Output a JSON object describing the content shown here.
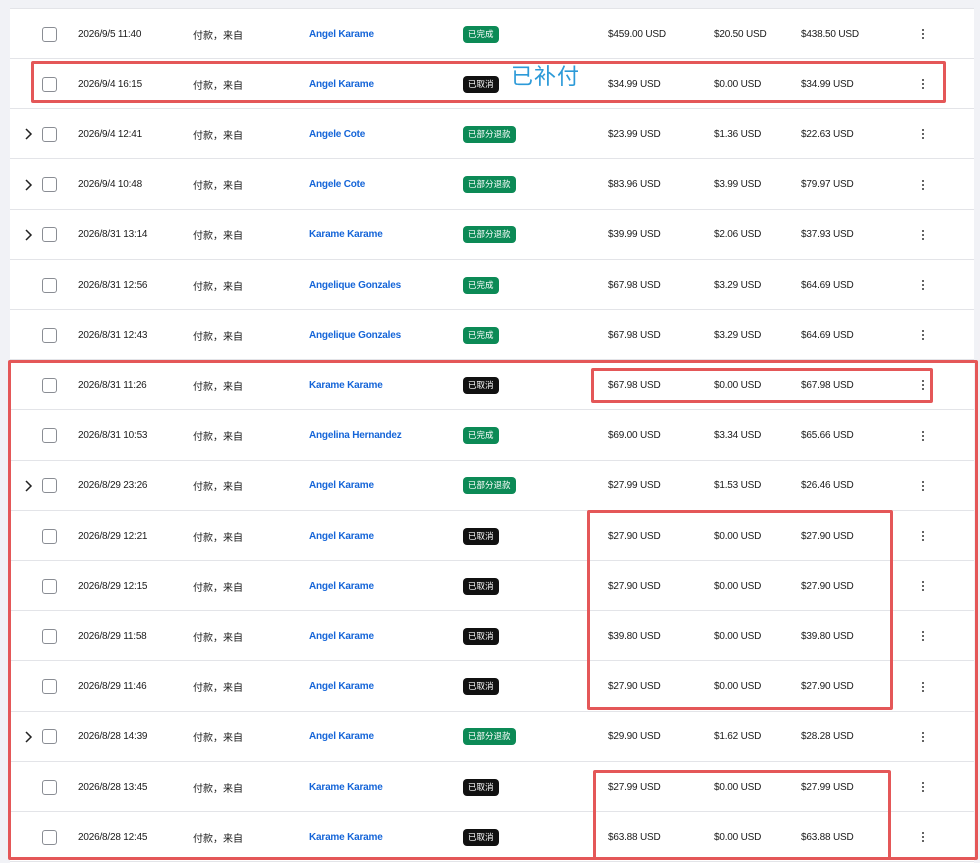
{
  "annotation_note": "已补付",
  "colors": {
    "link": "#1565d8",
    "badge_complete": "#0c8a56",
    "badge_partial_refund": "#0c8a56",
    "badge_cancelled": "#111111",
    "highlight": "#e45758",
    "note": "#2c9ad8"
  },
  "rows": [
    {
      "expandable": false,
      "date": "2026/9/5 11:40",
      "type": "付款，来自",
      "customer": "Angel Karame",
      "status": "已完成",
      "status_kind": "green",
      "amount": "$459.00 USD",
      "fee": "$20.50 USD",
      "net": "$438.50 USD"
    },
    {
      "expandable": false,
      "date": "2026/9/4 16:15",
      "type": "付款，来自",
      "customer": "Angel Karame",
      "status": "已取消",
      "status_kind": "black",
      "amount": "$34.99 USD",
      "fee": "$0.00 USD",
      "net": "$34.99 USD"
    },
    {
      "expandable": true,
      "date": "2026/9/4 12:41",
      "type": "付款，来自",
      "customer": "Angele Cote",
      "status": "已部分退款",
      "status_kind": "green",
      "amount": "$23.99 USD",
      "fee": "$1.36 USD",
      "net": "$22.63 USD"
    },
    {
      "expandable": true,
      "date": "2026/9/4 10:48",
      "type": "付款，来自",
      "customer": "Angele Cote",
      "status": "已部分退款",
      "status_kind": "green",
      "amount": "$83.96 USD",
      "fee": "$3.99 USD",
      "net": "$79.97 USD"
    },
    {
      "expandable": true,
      "date": "2026/8/31 13:14",
      "type": "付款，来自",
      "customer": "Karame Karame",
      "status": "已部分退款",
      "status_kind": "green",
      "amount": "$39.99 USD",
      "fee": "$2.06 USD",
      "net": "$37.93 USD"
    },
    {
      "expandable": false,
      "date": "2026/8/31 12:56",
      "type": "付款，来自",
      "customer": "Angelique Gonzales",
      "status": "已完成",
      "status_kind": "green",
      "amount": "$67.98 USD",
      "fee": "$3.29 USD",
      "net": "$64.69 USD"
    },
    {
      "expandable": false,
      "date": "2026/8/31 12:43",
      "type": "付款，来自",
      "customer": "Angelique Gonzales",
      "status": "已完成",
      "status_kind": "green",
      "amount": "$67.98 USD",
      "fee": "$3.29 USD",
      "net": "$64.69 USD"
    },
    {
      "expandable": false,
      "date": "2026/8/31 11:26",
      "type": "付款，来自",
      "customer": "Karame Karame",
      "status": "已取消",
      "status_kind": "black",
      "amount": "$67.98 USD",
      "fee": "$0.00 USD",
      "net": "$67.98 USD"
    },
    {
      "expandable": false,
      "date": "2026/8/31 10:53",
      "type": "付款，来自",
      "customer": "Angelina Hernandez",
      "status": "已完成",
      "status_kind": "green",
      "amount": "$69.00 USD",
      "fee": "$3.34 USD",
      "net": "$65.66 USD"
    },
    {
      "expandable": true,
      "date": "2026/8/29 23:26",
      "type": "付款，来自",
      "customer": "Angel Karame",
      "status": "已部分退款",
      "status_kind": "green",
      "amount": "$27.99 USD",
      "fee": "$1.53 USD",
      "net": "$26.46 USD"
    },
    {
      "expandable": false,
      "date": "2026/8/29 12:21",
      "type": "付款，来自",
      "customer": "Angel Karame",
      "status": "已取消",
      "status_kind": "black",
      "amount": "$27.90 USD",
      "fee": "$0.00 USD",
      "net": "$27.90 USD"
    },
    {
      "expandable": false,
      "date": "2026/8/29 12:15",
      "type": "付款，来自",
      "customer": "Angel Karame",
      "status": "已取消",
      "status_kind": "black",
      "amount": "$27.90 USD",
      "fee": "$0.00 USD",
      "net": "$27.90 USD"
    },
    {
      "expandable": false,
      "date": "2026/8/29 11:58",
      "type": "付款，来自",
      "customer": "Angel Karame",
      "status": "已取消",
      "status_kind": "black",
      "amount": "$39.80 USD",
      "fee": "$0.00 USD",
      "net": "$39.80 USD"
    },
    {
      "expandable": false,
      "date": "2026/8/29 11:46",
      "type": "付款，来自",
      "customer": "Angel Karame",
      "status": "已取消",
      "status_kind": "black",
      "amount": "$27.90 USD",
      "fee": "$0.00 USD",
      "net": "$27.90 USD"
    },
    {
      "expandable": true,
      "date": "2026/8/28 14:39",
      "type": "付款，来自",
      "customer": "Angel Karame",
      "status": "已部分退款",
      "status_kind": "green",
      "amount": "$29.90 USD",
      "fee": "$1.62 USD",
      "net": "$28.28 USD"
    },
    {
      "expandable": false,
      "date": "2026/8/28 13:45",
      "type": "付款，来自",
      "customer": "Karame Karame",
      "status": "已取消",
      "status_kind": "black",
      "amount": "$27.99 USD",
      "fee": "$0.00 USD",
      "net": "$27.99 USD"
    },
    {
      "expandable": false,
      "date": "2026/8/28 12:45",
      "type": "付款，来自",
      "customer": "Karame Karame",
      "status": "已取消",
      "status_kind": "black",
      "amount": "$63.88 USD",
      "fee": "$0.00 USD",
      "net": "$63.88 USD"
    }
  ]
}
